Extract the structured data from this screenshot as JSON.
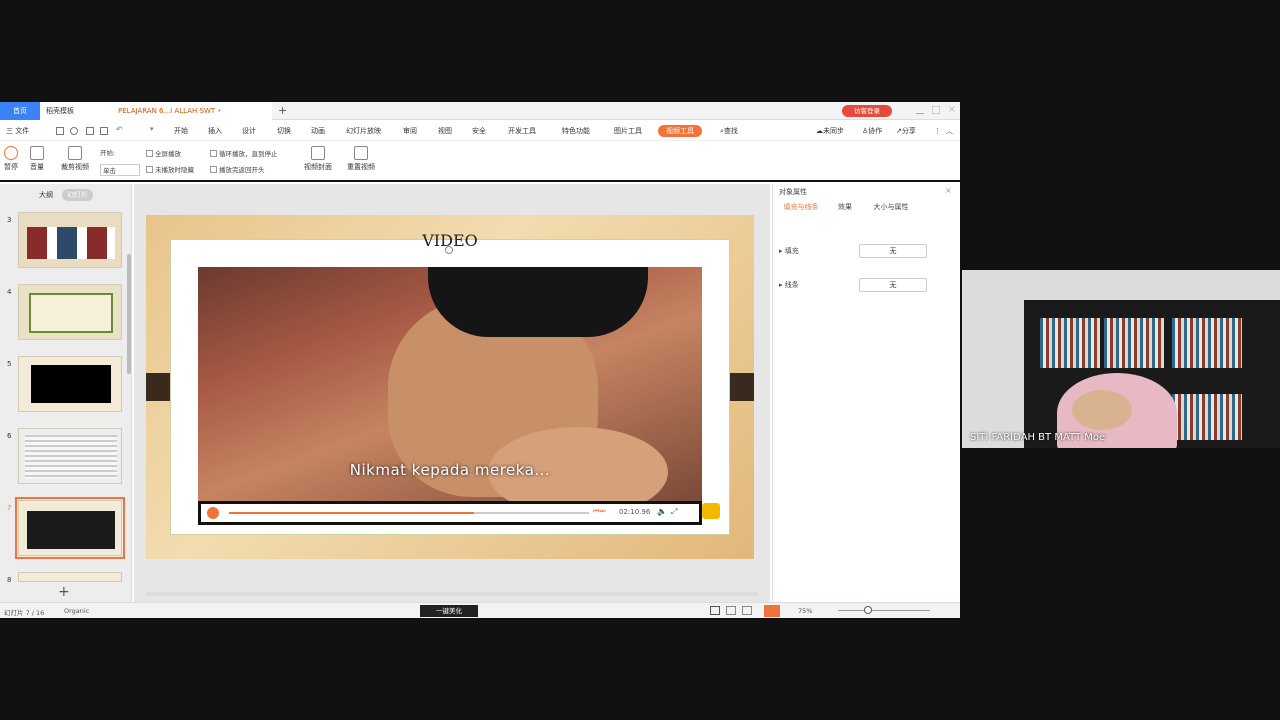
{
  "tabs": {
    "home": "首页",
    "template": "稻壳模板",
    "document": "PELAJARAN 6...I ALLAH SWT",
    "plus": "+",
    "login": "访客登录"
  },
  "menu": {
    "file": "三 文件",
    "items": [
      "开始",
      "插入",
      "设计",
      "切换",
      "动画",
      "幻灯片放映",
      "审阅",
      "视图",
      "安全",
      "开发工具",
      "特色功能",
      "图片工具"
    ],
    "active": "视频工具",
    "search": "查找",
    "sync": "未同步",
    "collab": "协作",
    "share": "分享"
  },
  "ribbon": {
    "pause": "暂停",
    "volume": "音量",
    "trim": "裁剪视频",
    "start_label": "开始:",
    "start_value": "单击",
    "fullscreen": "全屏播放",
    "hide_not_playing": "未播放时隐藏",
    "loop": "循环播放，直到停止",
    "rewind": "播放完返回开头",
    "cover": "视频封面",
    "reset": "重置视频"
  },
  "left_panel": {
    "tab_outline": "大纲",
    "tab_slides": "幻灯片",
    "slide_numbers": [
      "3",
      "4",
      "5",
      "6",
      "7",
      "8"
    ],
    "add": "+"
  },
  "slide": {
    "title": "VIDEO",
    "subtitle": "Nikmat kepada mereka...",
    "time": "02:10.96"
  },
  "right_panel": {
    "title": "对象属性",
    "tabs": [
      "填充与线条",
      "效果",
      "大小与属性"
    ],
    "fill_label": "填充",
    "fill_value": "无",
    "line_label": "线条",
    "line_value": "无"
  },
  "status": {
    "slide_info": "幻灯片 7 / 16",
    "theme": "Organic",
    "beautify": "一键美化",
    "zoom": "75%"
  },
  "webcam": {
    "name": "SITI FARIDAH BT MATT Moe"
  },
  "colors": {
    "accent": "#f2733a",
    "home_tab": "#3b82f6",
    "login": "#e64a3c"
  }
}
